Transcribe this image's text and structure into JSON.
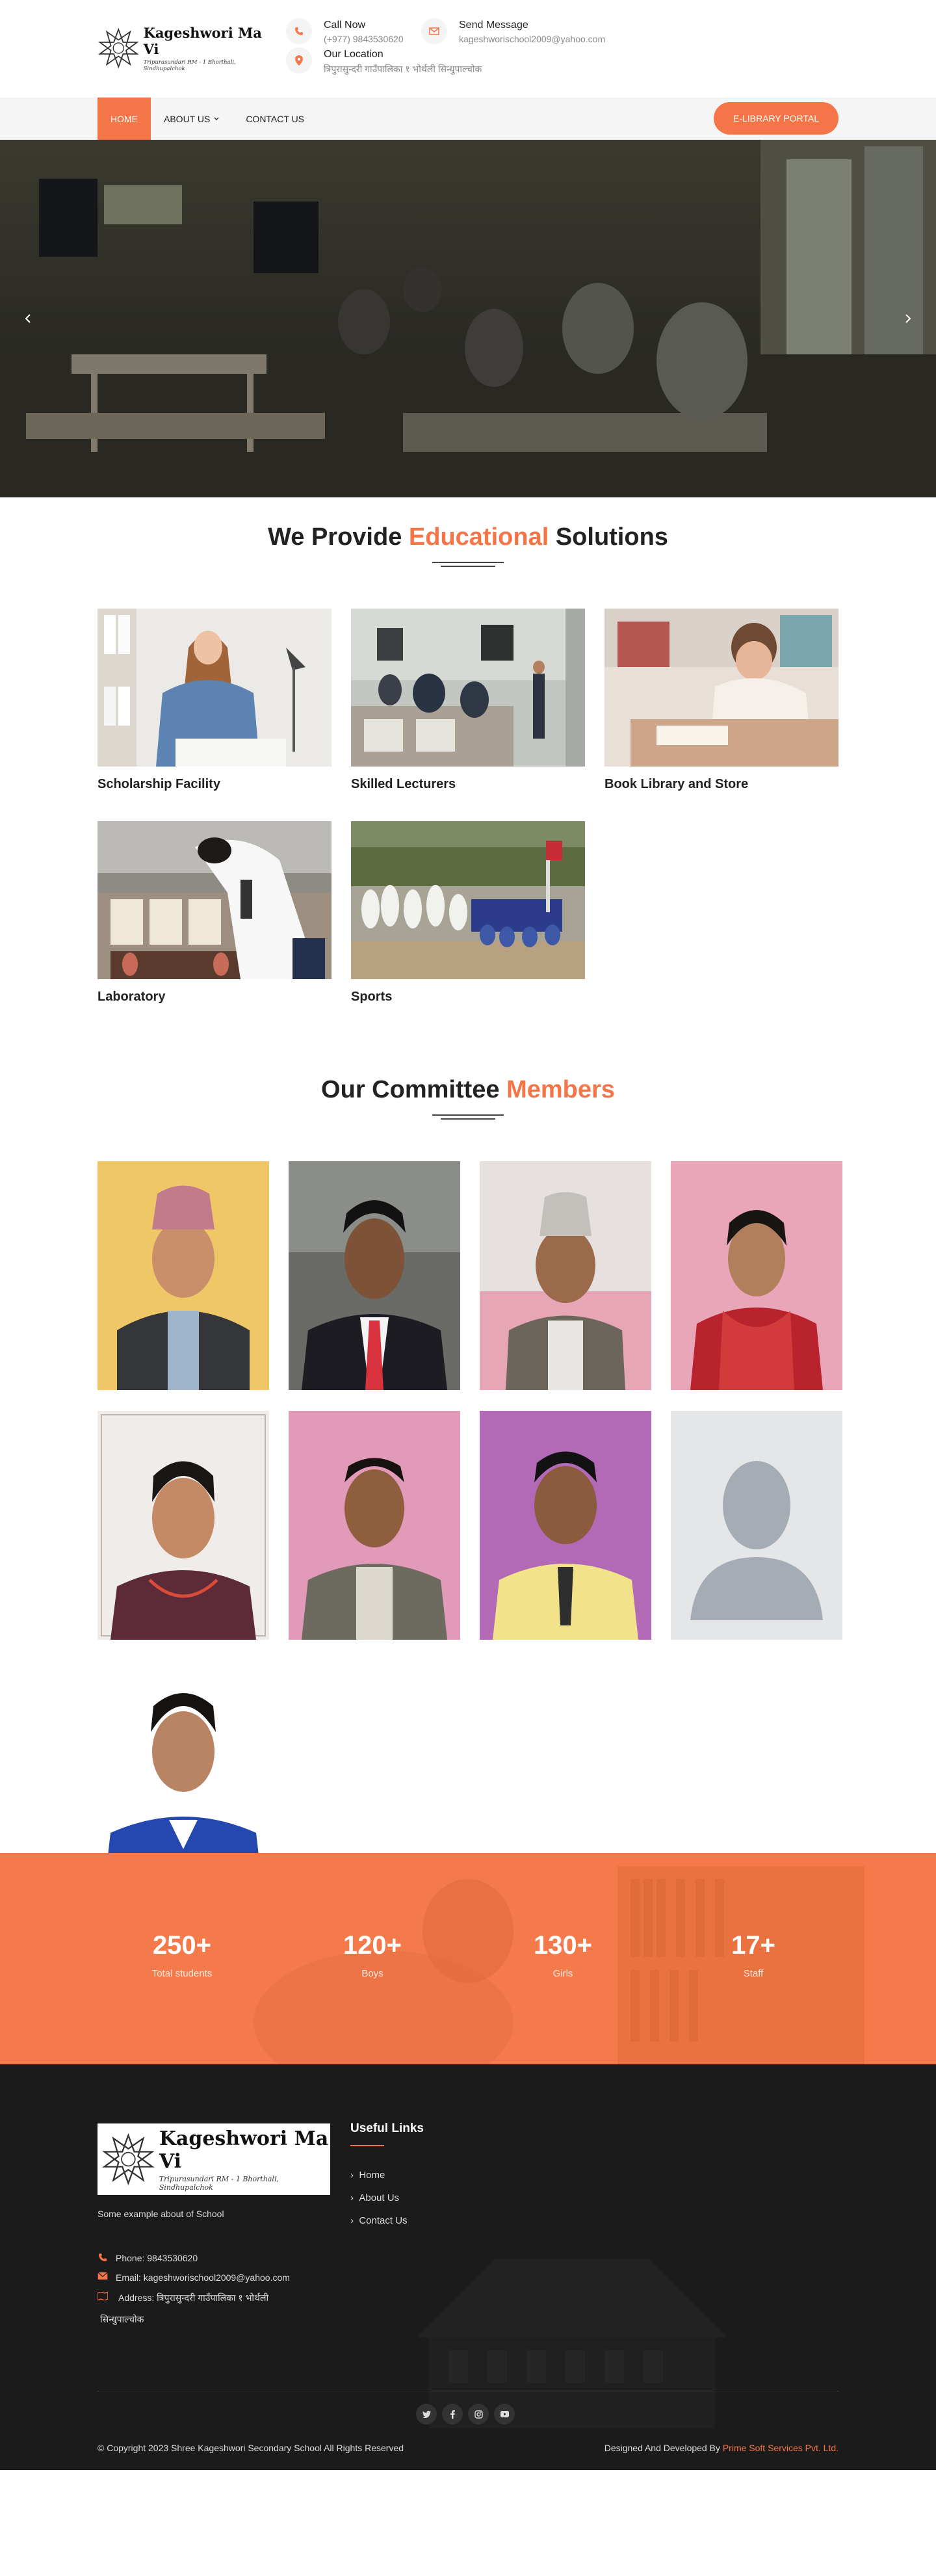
{
  "header": {
    "school_name": "Kageshwori Ma Vi",
    "school_sub": "Tripurasundari RM - 1 Bhorthali, Sindhupalchok",
    "call_title": "Call Now",
    "call_value": "(+977) 9843530620",
    "mail_title": "Send Message",
    "mail_value": "kageshworischool2009@yahoo.com",
    "location_title": "Our Location",
    "location_value": "त्रिपुरासुन्दरी गाउँपालिका १ भोर्थली सिन्धुपाल्चोक"
  },
  "nav": {
    "items": [
      {
        "label": "Home"
      },
      {
        "label": "About Us"
      },
      {
        "label": "Contact Us"
      }
    ],
    "portal_label": "E-Library Portal"
  },
  "solutions": {
    "title_a": "We Provide ",
    "title_hl": "Educational",
    "title_b": " Solutions",
    "cards": [
      {
        "title": "Scholarship Facility"
      },
      {
        "title": "Skilled Lecturers"
      },
      {
        "title": "Book Library and Store"
      },
      {
        "title": "Laboratory"
      },
      {
        "title": "Sports"
      }
    ]
  },
  "committee": {
    "title_a": "Our Committee ",
    "title_hl": "Members"
  },
  "stats": [
    {
      "value": "250+",
      "label": "Total students"
    },
    {
      "value": "120+",
      "label": "Boys"
    },
    {
      "value": "130+",
      "label": "Girls"
    },
    {
      "value": "17+",
      "label": "Staff"
    }
  ],
  "footer": {
    "about": "Some example about of School",
    "phone": "Phone: 9843530620",
    "email": "Email: kageshworischool2009@yahoo.com",
    "address_line1": "Address: त्रिपुरासुन्दरी गाउँपालिका १ भोर्थली",
    "address_line2": "सिन्धुपाल्चोक",
    "links_title": "Useful Links",
    "links": [
      {
        "label": "Home"
      },
      {
        "label": "About Us"
      },
      {
        "label": "Contact Us"
      }
    ],
    "copyright": "© Copyright 2023 Shree Kageshwori Secondary School All Rights Reserved",
    "dev_prefix": "Designed And Developed By ",
    "dev_name": "Prime Soft Services Pvt. Ltd."
  },
  "social_icons": [
    "twitter-icon",
    "facebook-icon",
    "instagram-icon",
    "youtube-icon"
  ],
  "colors": {
    "accent": "#f47547",
    "footer_bg": "#1c1c1c"
  }
}
